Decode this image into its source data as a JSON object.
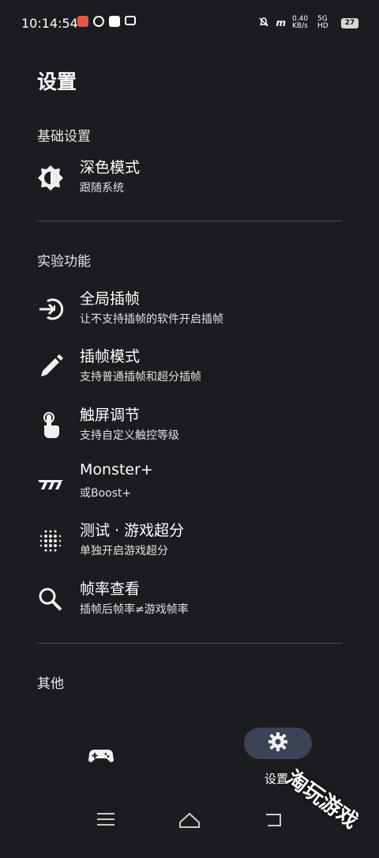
{
  "status_bar": {
    "time": "10:14:54",
    "network_speed": "0.40 KB/s",
    "network_type": "5G HD",
    "battery": "27"
  },
  "page": {
    "title": "设置"
  },
  "sections": {
    "basic": {
      "header": "基础设置"
    },
    "experimental": {
      "header": "实验功能"
    },
    "other": {
      "header": "其他"
    }
  },
  "items": {
    "dark_mode": {
      "title": "深色模式",
      "sub": "跟随系统",
      "icon": "brightness-icon"
    },
    "global_frame": {
      "title": "全局插帧",
      "sub": "让不支持插帧的软件开启插帧",
      "icon": "login-arrow-icon"
    },
    "frame_mode": {
      "title": "插帧模式",
      "sub": "支持普通插帧和超分插帧",
      "icon": "pencil-icon"
    },
    "touch": {
      "title": "触屏调节",
      "sub": "支持自定义触控等级",
      "icon": "touch-hand-icon"
    },
    "monster": {
      "title": "Monster+",
      "sub": "或Boost+",
      "icon": "monster-logo-icon"
    },
    "super_res": {
      "title": "测试 · 游戏超分",
      "sub": "单独开启游戏超分",
      "icon": "dot-grid-icon"
    },
    "frame_check": {
      "title": "帧率查看",
      "sub": "插帧后帧率≠游戏帧率",
      "icon": "search-icon"
    }
  },
  "bottom_nav": {
    "settings_label": "设置"
  },
  "watermark": "淘玩游戏"
}
